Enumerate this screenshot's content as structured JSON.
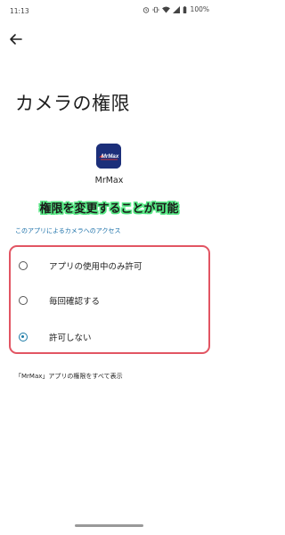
{
  "status_bar": {
    "time": "11:13",
    "battery": "100%"
  },
  "page": {
    "title": "カメラの権限"
  },
  "app": {
    "name": "MrMax",
    "icon_label": "MrMax",
    "icon_color": "#1c2f7a",
    "icon_accent": "#e8382e"
  },
  "annotation": {
    "text": "権限を変更することが可能"
  },
  "permission": {
    "section_label": "このアプリによるカメラへのアクセス",
    "options": [
      {
        "label": "アプリの使用中のみ許可",
        "selected": false
      },
      {
        "label": "毎回確認する",
        "selected": false
      },
      {
        "label": "許可しない",
        "selected": true
      }
    ]
  },
  "footer": {
    "link_text": "「MrMax」アプリの権限をすべて表示"
  },
  "colors": {
    "accent": "#1a7aa6",
    "highlight_border": "#e25563",
    "annotation_outline": "#56e884",
    "link_blue": "#1a6fa8"
  }
}
